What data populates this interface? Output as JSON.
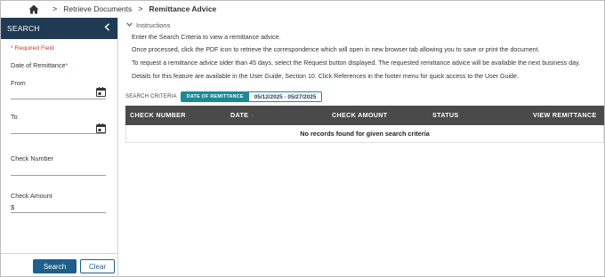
{
  "breadcrumb": {
    "home_icon": "home-icon",
    "separator": ">",
    "items": [
      "Retrieve Documents",
      "Remittance Advice"
    ]
  },
  "sidebar": {
    "title": "SEARCH",
    "collapse_icon": "chevron-left-icon",
    "required_note": "* Required Field",
    "date_label": "Date of Remittance",
    "required_star": "*",
    "from_label": "From",
    "from_value": "",
    "to_label": "To",
    "to_value": "",
    "check_number_label": "Check Number",
    "check_number_value": "",
    "check_amount_label": "Check Amount",
    "currency_symbol": "$",
    "check_amount_value": "",
    "calendar_icon": "calendar-icon",
    "search_button": "Search",
    "clear_button": "Clear"
  },
  "instructions": {
    "toggle_label": "Instructions",
    "lines": [
      "Enter the Search Criteria to view a remittance advice.",
      "Once processed, click the PDF icon to retrieve the correspondence which will open in new browser tab allowing you to save or print the document.",
      "To request a remittance advice older than 45 days, select the Request button displayed. The requested remittance advice will be available the next business day.",
      "Details for this feature are available in the User Guide, Section 10. Click References in the footer menu for quick access to the User Guide."
    ]
  },
  "criteria": {
    "label": "SEARCH CRITERIA",
    "chip_key": "DATE OF REMITTANCE",
    "chip_value": "05/12/2025 - 05/27/2025"
  },
  "table": {
    "columns": [
      "CHECK NUMBER",
      "DATE",
      "CHECK AMOUNT",
      "STATUS",
      "VIEW REMITTANCE"
    ],
    "sort_glyph": "↕",
    "empty_message": "No records found for given search criteria"
  },
  "colors": {
    "sidebar_header": "#1f3a52",
    "primary_button": "#1f5f8b",
    "chip_accent": "#1b8a93",
    "table_header": "#4a4a4a",
    "required": "#d0362f"
  }
}
